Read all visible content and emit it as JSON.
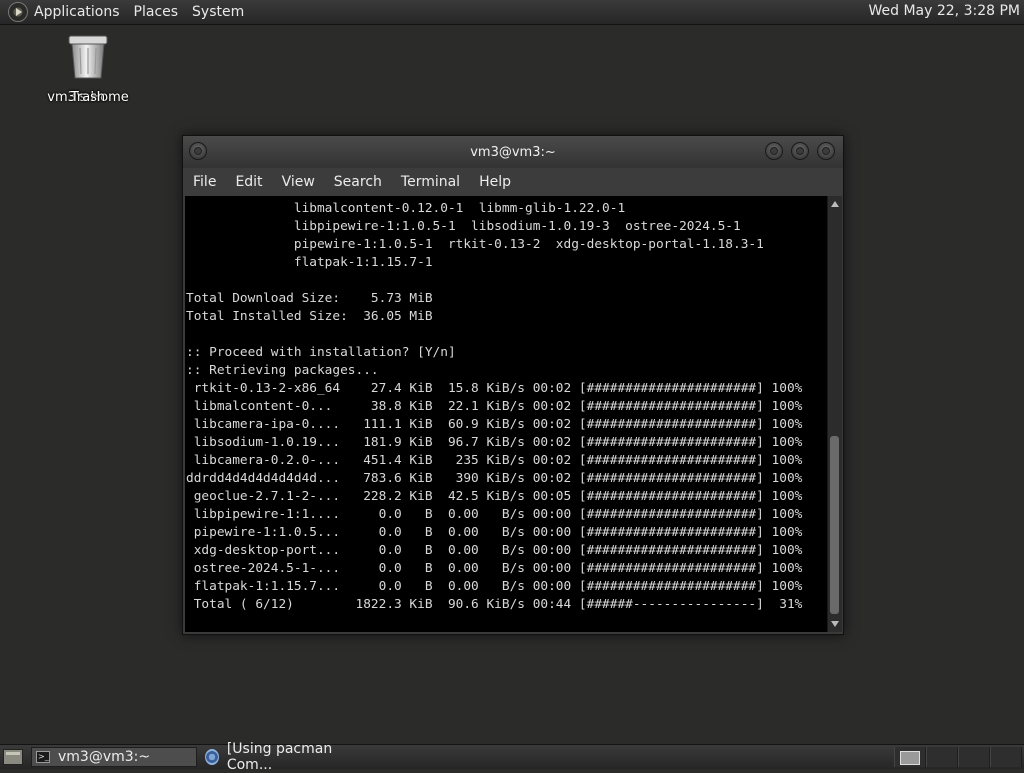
{
  "top_panel": {
    "menus": [
      "Applications",
      "Places",
      "System"
    ],
    "clock": "Wed May 22,  3:28 PM"
  },
  "desktop": {
    "icons": [
      {
        "label_a": "vm3's Home",
        "label_b": "Trash",
        "icon": "trash-icon"
      }
    ]
  },
  "terminal": {
    "title": "vm3@vm3:~",
    "menu": [
      "File",
      "Edit",
      "View",
      "Search",
      "Terminal",
      "Help"
    ],
    "lines": [
      "              libmalcontent-0.12.0-1  libmm-glib-1.22.0-1",
      "              libpipewire-1:1.0.5-1  libsodium-1.0.19-3  ostree-2024.5-1",
      "              pipewire-1:1.0.5-1  rtkit-0.13-2  xdg-desktop-portal-1.18.3-1",
      "              flatpak-1:1.15.7-1",
      "",
      "Total Download Size:    5.73 MiB",
      "Total Installed Size:  36.05 MiB",
      "",
      ":: Proceed with installation? [Y/n]",
      ":: Retrieving packages...",
      " rtkit-0.13-2-x86_64    27.4 KiB  15.8 KiB/s 00:02 [######################] 100%",
      " libmalcontent-0...     38.8 KiB  22.1 KiB/s 00:02 [######################] 100%",
      " libcamera-ipa-0....   111.1 KiB  60.9 KiB/s 00:02 [######################] 100%",
      " libsodium-1.0.19...   181.9 KiB  96.7 KiB/s 00:02 [######################] 100%",
      " libcamera-0.2.0-...   451.4 KiB   235 KiB/s 00:02 [######################] 100%",
      "ddrdd4d4d4d4d4d4d...   783.6 KiB   390 KiB/s 00:02 [######################] 100%",
      " geoclue-2.7.1-2-...   228.2 KiB  42.5 KiB/s 00:05 [######################] 100%",
      " libpipewire-1:1....     0.0   B  0.00   B/s 00:00 [######################] 100%",
      " pipewire-1:1.0.5...     0.0   B  0.00   B/s 00:00 [######################] 100%",
      " xdg-desktop-port...     0.0   B  0.00   B/s 00:00 [######################] 100%",
      " ostree-2024.5-1-...     0.0   B  0.00   B/s 00:00 [######################] 100%",
      " flatpak-1:1.15.7...     0.0   B  0.00   B/s 00:00 [######################] 100%",
      " Total ( 6/12)        1822.3 KiB  90.6 KiB/s 00:44 [######----------------]  31%"
    ]
  },
  "taskbar": {
    "tasks": [
      {
        "label": "vm3@vm3:~",
        "icon": "terminal-icon",
        "active": true
      },
      {
        "label": "[Using pacman Com...",
        "icon": "browser-icon",
        "active": false
      }
    ],
    "workspaces": 4,
    "current_workspace": 1
  }
}
